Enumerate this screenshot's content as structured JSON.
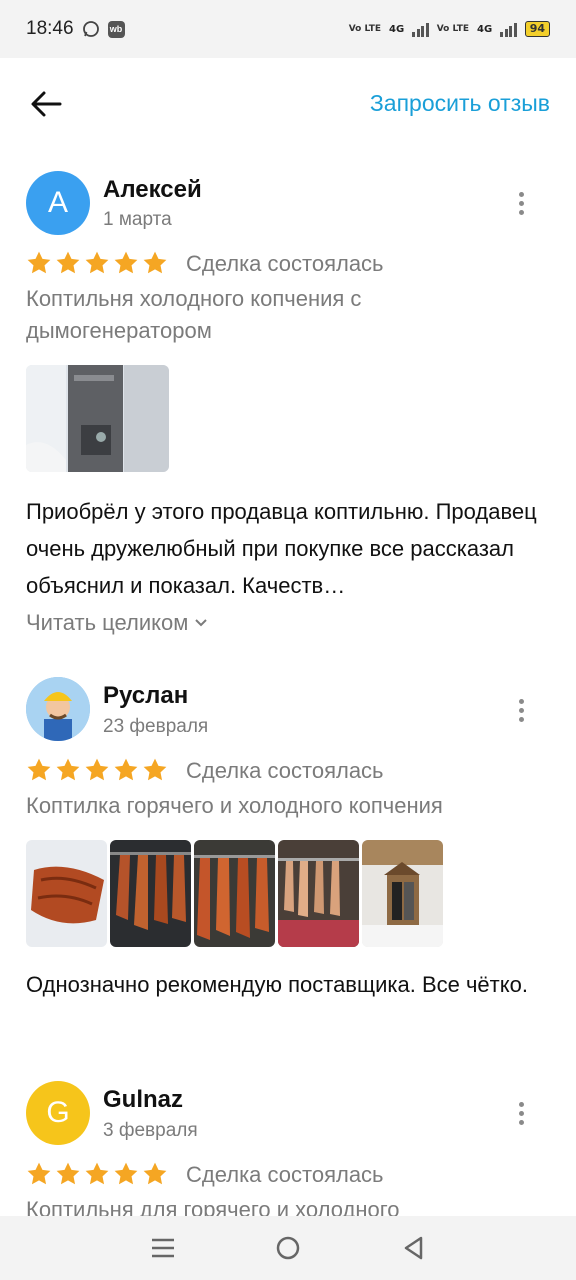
{
  "status_bar": {
    "time": "18:46",
    "wb_label": "wb",
    "net1": "Vo LTE",
    "net1_gen": "4G",
    "net2": "Vo LTE",
    "net2_gen": "4G",
    "battery": "94"
  },
  "header": {
    "back_icon": "arrow-left-icon",
    "request_review": "Запросить отзыв"
  },
  "accent_color": "#1a9fd8",
  "star_color": "#f5a623",
  "reviews": [
    {
      "avatar_letter": "А",
      "avatar_color": "#3aa0f0",
      "author": "Алексей",
      "date": "1 марта",
      "rating": 5,
      "deal_status": "Сделка состоялась",
      "product": "Коптильня холодного копчения с дымогенератором",
      "text": "Приобрёл у этого продавца коптильню. Продавец очень дружелюбный при покупке все рассказал объяснил и показал. Качеств…",
      "read_more": "Читать целиком"
    },
    {
      "avatar_letter": "",
      "avatar_color": "#8fc1ea",
      "author": "Руслан",
      "date": "23 февраля",
      "rating": 5,
      "deal_status": "Сделка состоялась",
      "product": "Коптилка горячего и холодного копчения",
      "text": "Однозначно рекомендую поставщика. Все чётко."
    },
    {
      "avatar_letter": "G",
      "avatar_color": "#f6c51b",
      "author": "Gulnaz",
      "date": "3 февраля",
      "rating": 5,
      "deal_status": "Сделка состоялась",
      "product": "Коптильня для горячего и холодного"
    }
  ],
  "nav_bar": {
    "menu_icon": "menu-icon",
    "home_icon": "home-circle-icon",
    "back_icon": "back-triangle-icon"
  }
}
